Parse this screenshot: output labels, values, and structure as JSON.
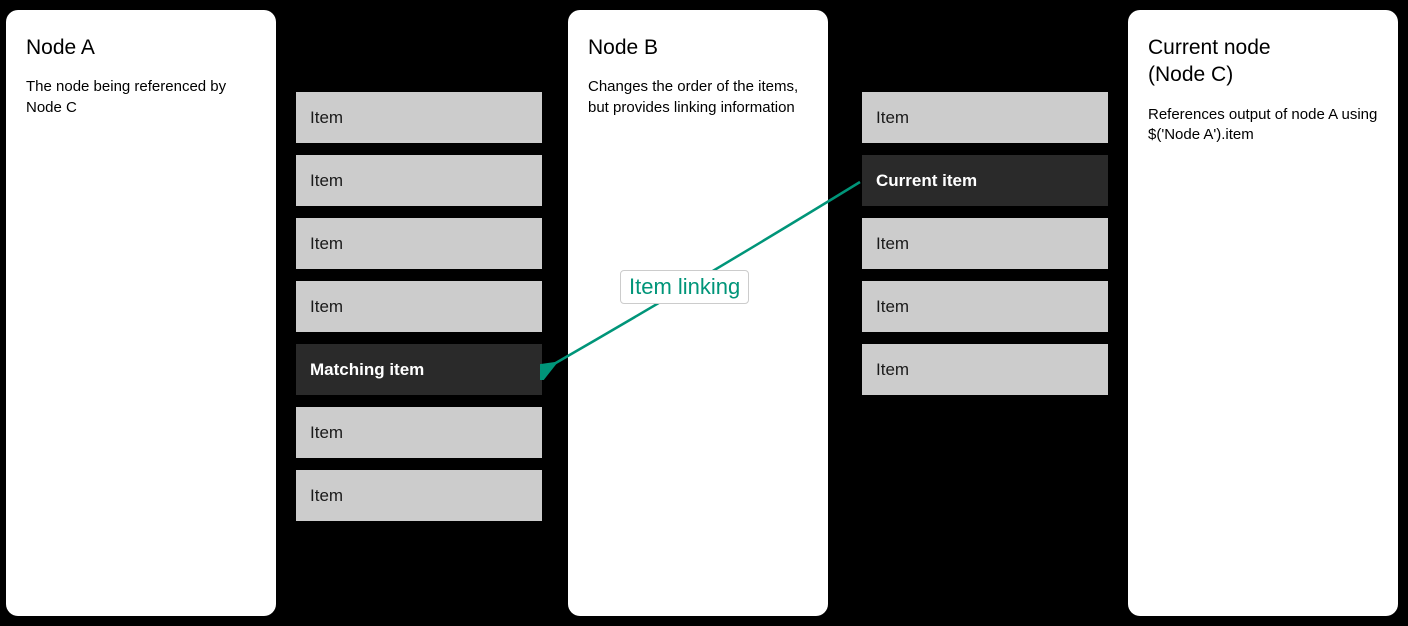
{
  "nodeA": {
    "title": "Node A",
    "description": "The node being referenced by Node C",
    "items": [
      {
        "label": "Item",
        "highlight": false
      },
      {
        "label": "Item",
        "highlight": false
      },
      {
        "label": "Item",
        "highlight": false
      },
      {
        "label": "Item",
        "highlight": false
      },
      {
        "label": "Matching item",
        "highlight": true
      },
      {
        "label": "Item",
        "highlight": false
      },
      {
        "label": "Item",
        "highlight": false
      }
    ]
  },
  "nodeB": {
    "title": "Node B",
    "description": "Changes the order of the items, but provides linking information",
    "items": [
      {
        "label": "Item",
        "highlight": false
      },
      {
        "label": "Current item",
        "highlight": true
      },
      {
        "label": "Item",
        "highlight": false
      },
      {
        "label": "Item",
        "highlight": false
      },
      {
        "label": "Item",
        "highlight": false
      }
    ]
  },
  "nodeC": {
    "title": "Current node\n(Node C)",
    "description": "References output of node A using $('Node A').item"
  },
  "link": {
    "label": "Item linking",
    "color": "#009579"
  }
}
